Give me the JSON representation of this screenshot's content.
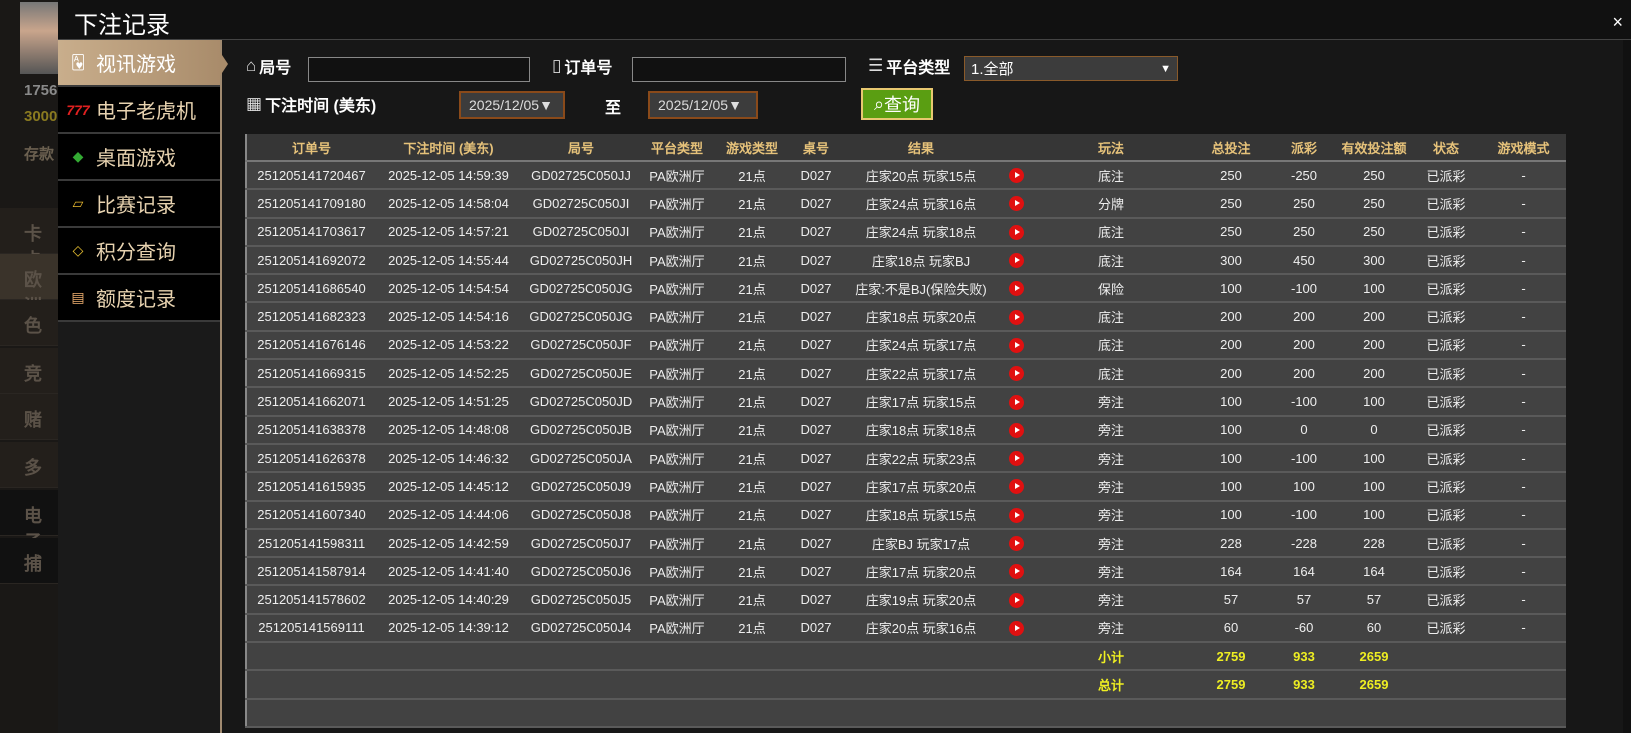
{
  "background": {
    "balance1": "1756",
    "balance2": "3000",
    "deposit": "存款",
    "items": [
      "卡卡",
      "欧洲",
      "色",
      "竞",
      "赌",
      "多",
      "电子",
      "捕"
    ]
  },
  "modal": {
    "title": "下注记录",
    "close": "×"
  },
  "menu": [
    {
      "label": "视讯游戏",
      "icon": "playing-cards-icon"
    },
    {
      "label": "电子老虎机",
      "icon": "slot-777-icon"
    },
    {
      "label": "桌面游戏",
      "icon": "chips-icon"
    },
    {
      "label": "比赛记录",
      "icon": "ticket-icon"
    },
    {
      "label": "积分查询",
      "icon": "diamond-icon"
    },
    {
      "label": "额度记录",
      "icon": "document-icon"
    }
  ],
  "filters": {
    "round_label": "局号",
    "round_value": "",
    "order_label": "订单号",
    "order_value": "",
    "platform_label": "平台类型",
    "platform_value": "1.全部",
    "time_label": "下注时间 (美东)",
    "date_from": "2025/12/05▼",
    "to_label": "至",
    "date_to": "2025/12/05▼",
    "query_button": "查询"
  },
  "colors": {
    "accent": "#e6c27a",
    "negative_payout": "#66cc11",
    "positive_payout": "#cc1133",
    "status": "#11dd11",
    "totals": "#eeee22"
  },
  "table": {
    "headers": [
      "订单号",
      "下注时间 (美东)",
      "局号",
      "平台类型",
      "游戏类型",
      "桌号",
      "结果",
      "",
      "玩法",
      "总投注",
      "派彩",
      "有效投注额",
      "状态",
      "游戏模式"
    ],
    "rows": [
      [
        "251205141720467",
        "2025-12-05 14:59:39",
        "GD02725C050JJ",
        "PA欧洲厅",
        "21点",
        "D027",
        "庄家20点 玩家15点",
        "底注",
        "250",
        "-250",
        "250",
        "已派彩",
        "-"
      ],
      [
        "251205141709180",
        "2025-12-05 14:58:04",
        "GD02725C050JI",
        "PA欧洲厅",
        "21点",
        "D027",
        "庄家24点 玩家16点",
        "分牌",
        "250",
        "250",
        "250",
        "已派彩",
        "-"
      ],
      [
        "251205141703617",
        "2025-12-05 14:57:21",
        "GD02725C050JI",
        "PA欧洲厅",
        "21点",
        "D027",
        "庄家24点 玩家18点",
        "底注",
        "250",
        "250",
        "250",
        "已派彩",
        "-"
      ],
      [
        "251205141692072",
        "2025-12-05 14:55:44",
        "GD02725C050JH",
        "PA欧洲厅",
        "21点",
        "D027",
        "庄家18点 玩家BJ",
        "底注",
        "300",
        "450",
        "300",
        "已派彩",
        "-"
      ],
      [
        "251205141686540",
        "2025-12-05 14:54:54",
        "GD02725C050JG",
        "PA欧洲厅",
        "21点",
        "D027",
        "庄家:不是BJ(保险失败)",
        "保险",
        "100",
        "-100",
        "100",
        "已派彩",
        "-"
      ],
      [
        "251205141682323",
        "2025-12-05 14:54:16",
        "GD02725C050JG",
        "PA欧洲厅",
        "21点",
        "D027",
        "庄家18点 玩家20点",
        "底注",
        "200",
        "200",
        "200",
        "已派彩",
        "-"
      ],
      [
        "251205141676146",
        "2025-12-05 14:53:22",
        "GD02725C050JF",
        "PA欧洲厅",
        "21点",
        "D027",
        "庄家24点 玩家17点",
        "底注",
        "200",
        "200",
        "200",
        "已派彩",
        "-"
      ],
      [
        "251205141669315",
        "2025-12-05 14:52:25",
        "GD02725C050JE",
        "PA欧洲厅",
        "21点",
        "D027",
        "庄家22点 玩家17点",
        "底注",
        "200",
        "200",
        "200",
        "已派彩",
        "-"
      ],
      [
        "251205141662071",
        "2025-12-05 14:51:25",
        "GD02725C050JD",
        "PA欧洲厅",
        "21点",
        "D027",
        "庄家17点 玩家15点",
        "旁注",
        "100",
        "-100",
        "100",
        "已派彩",
        "-"
      ],
      [
        "251205141638378",
        "2025-12-05 14:48:08",
        "GD02725C050JB",
        "PA欧洲厅",
        "21点",
        "D027",
        "庄家18点 玩家18点",
        "旁注",
        "100",
        "0",
        "0",
        "已派彩",
        "-"
      ],
      [
        "251205141626378",
        "2025-12-05 14:46:32",
        "GD02725C050JA",
        "PA欧洲厅",
        "21点",
        "D027",
        "庄家22点 玩家23点",
        "旁注",
        "100",
        "-100",
        "100",
        "已派彩",
        "-"
      ],
      [
        "251205141615935",
        "2025-12-05 14:45:12",
        "GD02725C050J9",
        "PA欧洲厅",
        "21点",
        "D027",
        "庄家17点 玩家20点",
        "旁注",
        "100",
        "100",
        "100",
        "已派彩",
        "-"
      ],
      [
        "251205141607340",
        "2025-12-05 14:44:06",
        "GD02725C050J8",
        "PA欧洲厅",
        "21点",
        "D027",
        "庄家18点 玩家15点",
        "旁注",
        "100",
        "-100",
        "100",
        "已派彩",
        "-"
      ],
      [
        "251205141598311",
        "2025-12-05 14:42:59",
        "GD02725C050J7",
        "PA欧洲厅",
        "21点",
        "D027",
        "庄家BJ 玩家17点",
        "旁注",
        "228",
        "-228",
        "228",
        "已派彩",
        "-"
      ],
      [
        "251205141587914",
        "2025-12-05 14:41:40",
        "GD02725C050J6",
        "PA欧洲厅",
        "21点",
        "D027",
        "庄家17点 玩家20点",
        "旁注",
        "164",
        "164",
        "164",
        "已派彩",
        "-"
      ],
      [
        "251205141578602",
        "2025-12-05 14:40:29",
        "GD02725C050J5",
        "PA欧洲厅",
        "21点",
        "D027",
        "庄家19点 玩家20点",
        "旁注",
        "57",
        "57",
        "57",
        "已派彩",
        "-"
      ],
      [
        "251205141569111",
        "2025-12-05 14:39:12",
        "GD02725C050J4",
        "PA欧洲厅",
        "21点",
        "D027",
        "庄家20点 玩家16点",
        "旁注",
        "60",
        "-60",
        "60",
        "已派彩",
        "-"
      ]
    ],
    "subtotal": {
      "label": "小计",
      "total_bet": "2759",
      "payout": "933",
      "valid_bet": "2659"
    },
    "total": {
      "label": "总计",
      "total_bet": "2759",
      "payout": "933",
      "valid_bet": "2659"
    }
  }
}
